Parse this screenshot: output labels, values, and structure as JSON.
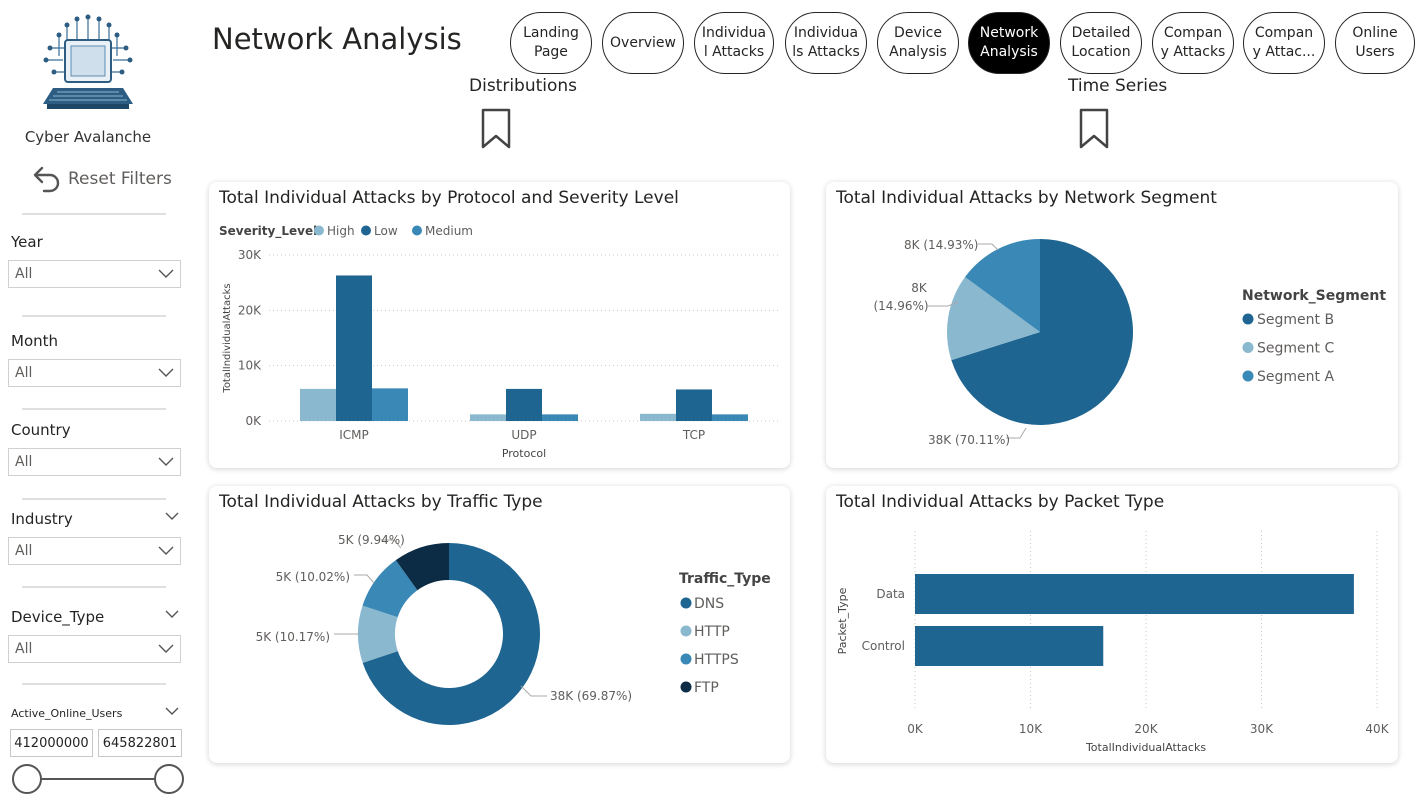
{
  "sidebar": {
    "brand": "Cyber Avalanche",
    "reset_label": "Reset Filters",
    "slicers": [
      {
        "title": "Year",
        "value": "All"
      },
      {
        "title": "Month",
        "value": "All"
      },
      {
        "title": "Country",
        "value": "All"
      },
      {
        "title": "Industry",
        "value": "All"
      },
      {
        "title": "Device_Type",
        "value": "All"
      }
    ],
    "range_slicer": {
      "title": "Active_Online_Users",
      "min": "412000000",
      "max": "645822801"
    }
  },
  "header": {
    "title": "Network Analysis",
    "nav": [
      {
        "label": "Landing Page",
        "l1": "Landing",
        "l2": "Page"
      },
      {
        "label": "Overview",
        "l1": "Overview",
        "l2": ""
      },
      {
        "label": "Individual Attacks",
        "l1": "Individua",
        "l2": "l Attacks"
      },
      {
        "label": "Individuals Attacks",
        "l1": "Individua",
        "l2": "ls Attacks"
      },
      {
        "label": "Device Analysis",
        "l1": "Device",
        "l2": "Analysis"
      },
      {
        "label": "Network Analysis",
        "l1": "Network",
        "l2": "Analysis",
        "active": true
      },
      {
        "label": "Detailed Location",
        "l1": "Detailed",
        "l2": "Location"
      },
      {
        "label": "Company Attacks",
        "l1": "Compan",
        "l2": "y Attacks"
      },
      {
        "label": "Company Attac...",
        "l1": "Compan",
        "l2": "y Attac..."
      },
      {
        "label": "Online Users",
        "l1": "Online",
        "l2": "Users"
      }
    ],
    "sections": [
      "Distributions",
      "Time Series"
    ]
  },
  "colors": {
    "dark": "#1f6591",
    "light": "#8ab8cf",
    "mid": "#3a88b5",
    "darkest": "#0c2b45"
  },
  "chart_data": [
    {
      "type": "bar",
      "title": "Total Individual Attacks by Protocol and Severity Level",
      "legend_title": "Severity_Level",
      "categories": [
        "ICMP",
        "UDP",
        "TCP"
      ],
      "series": [
        {
          "name": "High",
          "values": [
            5800,
            1200,
            1300
          ]
        },
        {
          "name": "Low",
          "values": [
            26300,
            5800,
            5700
          ]
        },
        {
          "name": "Medium",
          "values": [
            5900,
            1200,
            1200
          ]
        }
      ],
      "yticks": [
        "0K",
        "10K",
        "20K",
        "30K"
      ],
      "xlabel": "Protocol",
      "ylabel": "TotalIndividualAttacks",
      "ylim": [
        0,
        30000
      ]
    },
    {
      "type": "pie",
      "title": "Total Individual Attacks by Network Segment",
      "legend_title": "Network_Segment",
      "slices": [
        {
          "name": "Segment B",
          "value": 70.11,
          "label": "38K (70.11%)"
        },
        {
          "name": "Segment C",
          "value": 14.96,
          "label_l1": "8K",
          "label_l2": "(14.96%)"
        },
        {
          "name": "Segment A",
          "value": 14.93,
          "label": "8K (14.93%)"
        }
      ]
    },
    {
      "type": "pie",
      "title": "Total Individual Attacks by Traffic Type",
      "legend_title": "Traffic_Type",
      "slices": [
        {
          "name": "DNS",
          "value": 69.87,
          "label": "38K (69.87%)"
        },
        {
          "name": "HTTP",
          "value": 10.17,
          "label": "5K (10.17%)"
        },
        {
          "name": "HTTPS",
          "value": 10.02,
          "label": "5K (10.02%)"
        },
        {
          "name": "FTP",
          "value": 9.94,
          "label": "5K (9.94%)"
        }
      ]
    },
    {
      "type": "bar",
      "title": "Total Individual Attacks by Packet Type",
      "categories": [
        "Data",
        "Control"
      ],
      "values": [
        38000,
        16300
      ],
      "xticks": [
        "0K",
        "10K",
        "20K",
        "30K",
        "40K"
      ],
      "xlabel": "TotalIndividualAttacks",
      "ylabel": "Packet_Type",
      "xlim": [
        0,
        40000
      ]
    }
  ]
}
